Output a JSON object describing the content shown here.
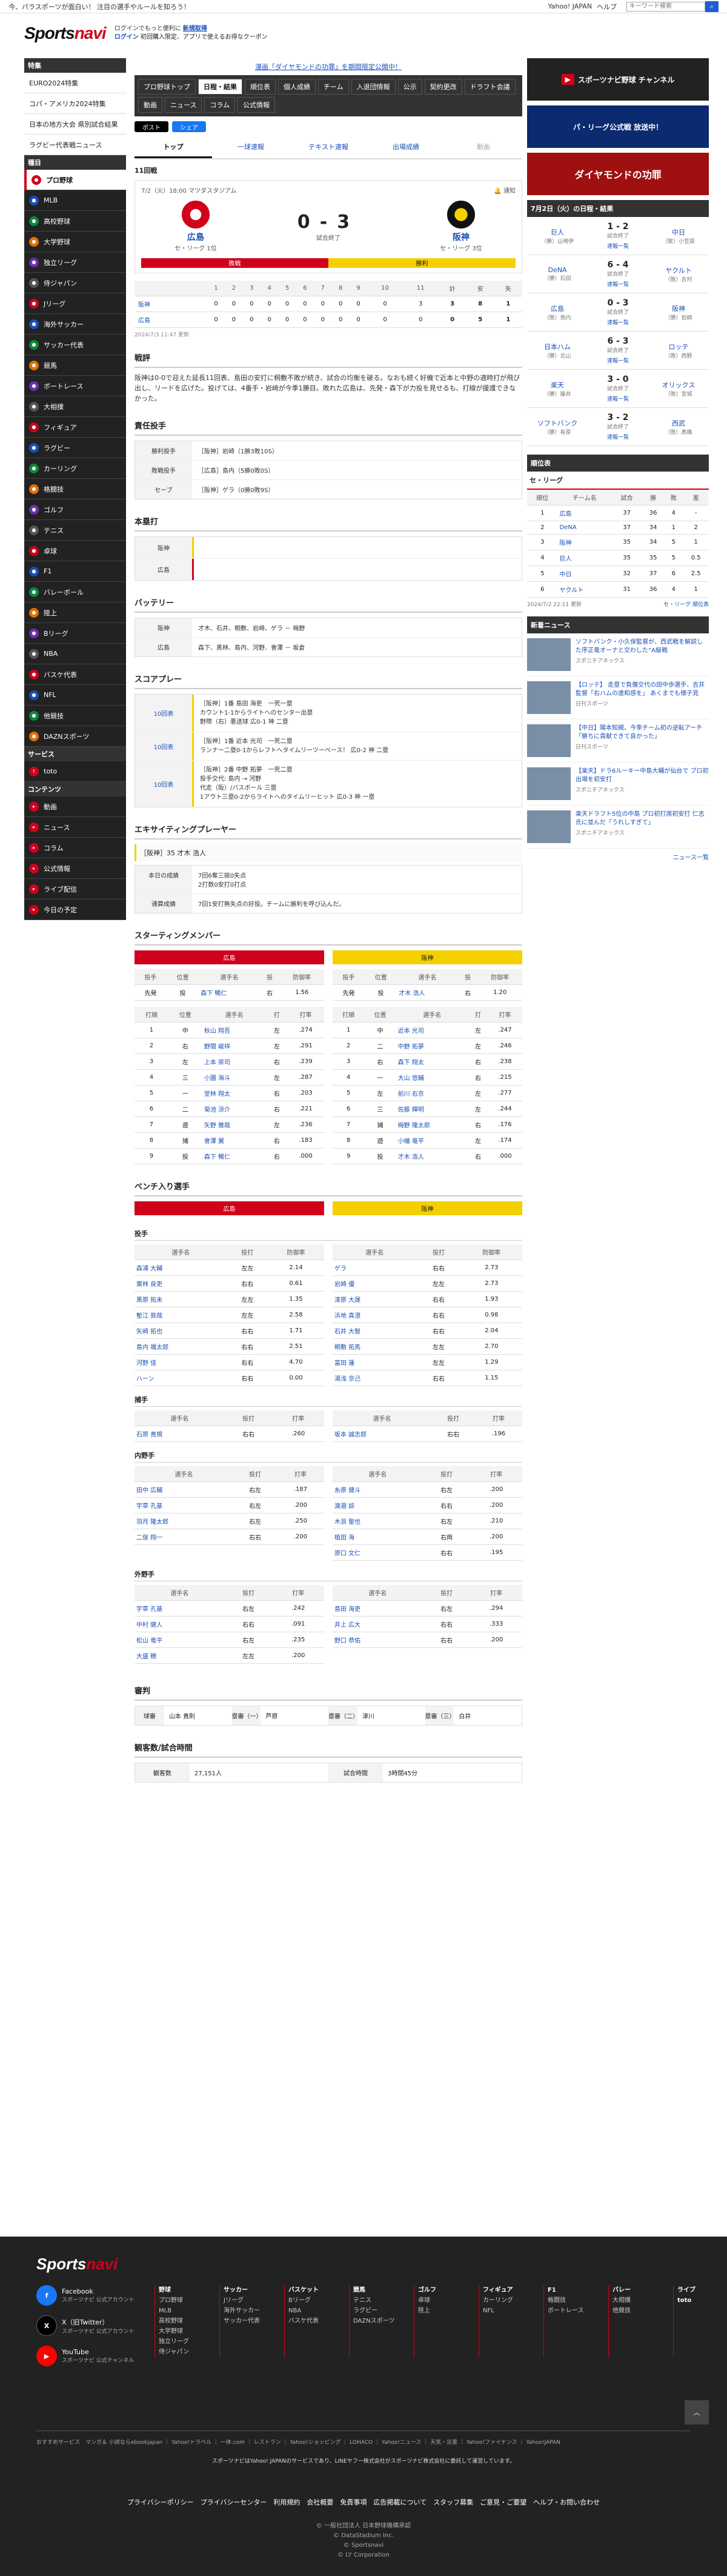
{
  "topbar": {
    "ticker": "今、パラスポーツが面白い！ 注目の選手やルールを知ろう！",
    "yahoo": "Yahoo! JAPAN",
    "help": "ヘルプ",
    "search_placeholder": "キーワード検索"
  },
  "header": {
    "logo_a": "Sports",
    "logo_b": "navi",
    "promo1_a": "ログインでもっと便利に",
    "promo1_b": "新規取得",
    "promo2_a": "ログイン",
    "promo2_b": "初回購入限定、アプリで使えるお得なクーポン"
  },
  "sidebar": {
    "head1": "特集",
    "feature": [
      "EURO2024特集",
      "コパ・アメリカ2024特集",
      "日本の地方大会 県別試合結果",
      "ラグビー代表戦ニュース"
    ],
    "head2": "種目",
    "sports": [
      "プロ野球",
      "MLB",
      "高校野球",
      "大学野球",
      "独立リーグ",
      "侍ジャパン",
      "Jリーグ",
      "海外サッカー",
      "サッカー代表",
      "競馬",
      "ボートレース",
      "大相撲",
      "フィギュア",
      "ラグビー",
      "カーリング",
      "格闘技",
      "ゴルフ",
      "テニス",
      "卓球",
      "F1",
      "バレーボール",
      "陸上",
      "Bリーグ",
      "NBA",
      "バスケ代表",
      "NFL",
      "他競技",
      "DAZNスポーツ"
    ],
    "head3": "サービス",
    "services": [
      "toto"
    ],
    "head4": "コンテンツ",
    "contents": [
      "動画",
      "ニュース",
      "コラム",
      "公式情報",
      "ライブ配信",
      "今日の予定"
    ]
  },
  "main": {
    "notice": "漫画「ダイヤモンドの功罪」を期間限定公開中！",
    "tabs": [
      "プロ野球トップ",
      "日程・結果",
      "順位表",
      "個人成績",
      "チーム",
      "入退団情報",
      "公示",
      "契約更改",
      "ドラフト会議",
      "動画",
      "ニュース",
      "コラム",
      "公式情報"
    ],
    "share_x": "ポスト",
    "share_fb": "シェア",
    "subtabs": [
      "トップ",
      "一球速報",
      "テキスト速報",
      "出場成績",
      "動画"
    ],
    "inning": "11回戦",
    "date": "7/2（火）18:00 マツダスタジアム",
    "notify": "通知",
    "home": {
      "name": "広島",
      "sub": "セ・リーグ 1位",
      "runs": "0"
    },
    "away": {
      "name": "阪神",
      "sub": "セ・リーグ 3位",
      "runs": "3"
    },
    "status": "試合終了",
    "lose": "敗戦",
    "win": "勝利",
    "linescore": {
      "headers": [
        "",
        "1",
        "2",
        "3",
        "4",
        "5",
        "6",
        "7",
        "8",
        "9",
        "10",
        "11",
        "計",
        "安",
        "失"
      ],
      "rows": [
        [
          "阪神",
          "0",
          "0",
          "0",
          "0",
          "0",
          "0",
          "0",
          "0",
          "0",
          "0",
          "3",
          "3",
          "8",
          "1"
        ],
        [
          "広島",
          "0",
          "0",
          "0",
          "0",
          "0",
          "0",
          "0",
          "0",
          "0",
          "0",
          "0",
          "0",
          "5",
          "1"
        ]
      ]
    },
    "updated": "2024/7/3 11:47 更新",
    "summary_title": "戦評",
    "summary": "阪神は0-0で迎えた延長11回表、島田の安打に桐敷不敗が続き、試合の均衡を破る。なおも続く好機で近本と中野の適時打が飛び出し、リードを広げた。投げては、4番手・岩崎が今季1勝目。敗れた広島は、先発・森下が力投を見せるも、打線が援護できなかった。",
    "pitchers_title": "責任投手",
    "pitchers": [
      {
        "k": "勝利投手",
        "v": "［阪神］岩崎（1勝3敗10S）"
      },
      {
        "k": "敗戦投手",
        "v": "［広島］島内（5勝0敗0S）"
      },
      {
        "k": "セーブ",
        "v": "［阪神］ゲラ（0勝0敗9S）"
      }
    ],
    "hr_title": "本塁打",
    "hr": [
      {
        "k": "阪神"
      },
      {
        "k": "広島"
      }
    ],
    "battery_title": "バッテリー",
    "battery": [
      {
        "k": "阪神",
        "v": "才木、石井、桐敷、岩崎、ゲラ － 梅野"
      },
      {
        "k": "広島",
        "v": "森下、黒林、島内、河野、會澤 － 坂倉"
      }
    ],
    "scoring_title": "スコアプレー",
    "scoring": [
      {
        "k": "10回表",
        "v": "［阪神］1番 島田 海吏　一死一塁\nカウント1-1からライトへのセンター出塁\n野際（右）悪送球 広0-1 神 二塁"
      },
      {
        "k": "10回表",
        "v": "［阪神］1番 近本 光司　一死二塁\nランナー二塁0-1からレフトへタイムリーツーベース！ 広0-2 神 二塁"
      },
      {
        "k": "10回表",
        "v": "［阪神］2番 中野 拓夢　一死二塁\n投手交代: 島内 → 河野\n代走（阪）/バスボール 三塁\n1アウト三塁0-2からライトへのタイムリーヒット 広0-3 神 一塁"
      }
    ],
    "mvp_title": "エキサイティングプレーヤー",
    "mvp_name": "［阪神］35 才木 浩人",
    "mvp": [
      {
        "k": "本日の成績",
        "v": "7回6奪三振0失点\n2打数0安打0打点"
      },
      {
        "k": "通算成績",
        "v": "7回1安打無失点の好投。チームに勝利を呼び込んだ。"
      }
    ],
    "lineup_title": "スターティングメンバー",
    "lineup_home_label": "広島",
    "lineup_away_label": "阪神",
    "sp_headers": [
      "投手",
      "位置",
      "選手名",
      "投",
      "防御率"
    ],
    "sp_home": [
      "先発",
      "投",
      "森下 暢仁",
      "右",
      "1.56"
    ],
    "sp_away": [
      "先発",
      "投",
      "才木 浩人",
      "右",
      "1.20"
    ],
    "bat_headers": [
      "打順",
      "位置",
      "選手名",
      "打",
      "打率"
    ],
    "bat_home": [
      [
        "1",
        "中",
        "秋山 翔吾",
        "左",
        ".274"
      ],
      [
        "2",
        "右",
        "野間 峻祥",
        "左",
        ".291"
      ],
      [
        "3",
        "左",
        "上本 崇司",
        "右",
        ".239"
      ],
      [
        "4",
        "三",
        "小園 海斗",
        "左",
        ".287"
      ],
      [
        "5",
        "一",
        "堂林 翔太",
        "右",
        ".203"
      ],
      [
        "6",
        "二",
        "菊池 涼介",
        "右",
        ".221"
      ],
      [
        "7",
        "遊",
        "矢野 雅哉",
        "左",
        ".236"
      ],
      [
        "8",
        "捕",
        "會澤 翼",
        "右",
        ".183"
      ],
      [
        "9",
        "投",
        "森下 暢仁",
        "右",
        ".000"
      ]
    ],
    "bat_away": [
      [
        "1",
        "中",
        "近本 光司",
        "左",
        ".247"
      ],
      [
        "2",
        "二",
        "中野 拓夢",
        "左",
        ".246"
      ],
      [
        "3",
        "右",
        "森下 翔太",
        "右",
        ".238"
      ],
      [
        "4",
        "一",
        "大山 悠輔",
        "右",
        ".215"
      ],
      [
        "5",
        "左",
        "前川 右京",
        "左",
        ".277"
      ],
      [
        "6",
        "三",
        "佐藤 輝明",
        "左",
        ".244"
      ],
      [
        "7",
        "捕",
        "梅野 隆太郎",
        "右",
        ".176"
      ],
      [
        "8",
        "遊",
        "小幡 竜平",
        "左",
        ".174"
      ],
      [
        "9",
        "投",
        "才木 浩人",
        "右",
        ".000"
      ]
    ],
    "bench_title": "ベンチ入り選手",
    "bench_pitch": "投手",
    "bench_p_headers": [
      "選手名",
      "投打",
      "防御率"
    ],
    "bench_p_home": [
      [
        "森浦 大輔",
        "左左",
        "2.14"
      ],
      [
        "栗林 良吏",
        "右右",
        "0.61"
      ],
      [
        "黒原 拓未",
        "左左",
        "1.35"
      ],
      [
        "塹江 敦哉",
        "左左",
        "2.58"
      ],
      [
        "矢崎 拓也",
        "右右",
        "1.71"
      ],
      [
        "島内 颯太郎",
        "右右",
        "2.51"
      ],
      [
        "河野 佳",
        "右右",
        "4.70"
      ],
      [
        "ハーン",
        "右右",
        "0.00"
      ]
    ],
    "bench_p_away": [
      [
        "ゲラ",
        "右右",
        "2.73"
      ],
      [
        "岩崎 優",
        "左左",
        "2.73"
      ],
      [
        "漆原 大晟",
        "右右",
        "1.93"
      ],
      [
        "浜地 真澄",
        "右右",
        "0.98"
      ],
      [
        "石井 大智",
        "右右",
        "2.04"
      ],
      [
        "桐敷 拓馬",
        "左左",
        "2.70"
      ],
      [
        "富田 蓮",
        "左左",
        "1.29"
      ],
      [
        "湯浅 京己",
        "右右",
        "1.15"
      ]
    ],
    "bench_catch": "捕手",
    "bench_b_headers": [
      "選手名",
      "投打",
      "打率"
    ],
    "bench_c_home": [
      [
        "石原 貴規",
        "右右",
        ".260"
      ]
    ],
    "bench_c_away": [
      [
        "坂本 誠志郎",
        "右右",
        ".196"
      ]
    ],
    "bench_inf": "内野手",
    "bench_i_home": [
      [
        "田中 広輔",
        "右左",
        ".187"
      ],
      [
        "宇草 孔基",
        "右左",
        ".200"
      ],
      [
        "羽月 隆太郎",
        "右左",
        ".250"
      ],
      [
        "二俣 翔一",
        "右右",
        ".200"
      ]
    ],
    "bench_i_away": [
      [
        "糸原 健斗",
        "右左",
        ".200"
      ],
      [
        "渡邉 諒",
        "右右",
        ".200"
      ],
      [
        "木浪 聖也",
        "右左",
        ".210"
      ],
      [
        "植田 海",
        "右両",
        ".200"
      ],
      [
        "原口 文仁",
        "右右",
        ".195"
      ]
    ],
    "bench_out": "外野手",
    "bench_o_home": [
      [
        "宇草 孔基",
        "右左",
        ".242"
      ],
      [
        "中村 健人",
        "右右",
        ".091"
      ],
      [
        "松山 竜平",
        "右左",
        ".235"
      ],
      [
        "大盛 穂",
        "左左",
        ".200"
      ]
    ],
    "bench_o_away": [
      [
        "島田 海吏",
        "右左",
        ".294"
      ],
      [
        "井上 広大",
        "右右",
        ".333"
      ],
      [
        "野口 恭佑",
        "右右",
        ".200"
      ]
    ],
    "ump_title": "審判",
    "umps": [
      {
        "k": "球審",
        "v": "山本 貴則"
      },
      {
        "k": "塁審（一）",
        "v": "芦原"
      },
      {
        "k": "塁審（二）",
        "v": "津川"
      },
      {
        "k": "塁審（三）",
        "v": "白井"
      }
    ],
    "att_title": "観客数/試合時間",
    "att": {
      "k1": "観客数",
      "v1": "27,151人",
      "k2": "試合時間",
      "v2": "3時間45分"
    }
  },
  "right": {
    "banner1": "スポーツナビ野球 チャンネル",
    "banner2": "パ・リーグ公式戦 放送中！",
    "banner3": "ダイヤモンドの功罪",
    "schedule_title": "7月2日（火）の日程・結果",
    "games": [
      {
        "a": "巨人",
        "ap": "（勝）山﨑伊",
        "s": "1 - 2",
        "b": "中日",
        "bp": "（敗）小笠原"
      },
      {
        "a": "DeNA",
        "ap": "（勝）石田",
        "s": "6 - 4",
        "b": "ヤクルト",
        "bp": "（敗）吉村"
      },
      {
        "a": "広島",
        "ap": "（敗）島内",
        "s": "0 - 3",
        "b": "阪神",
        "bp": "（勝）岩崎"
      },
      {
        "a": "日本ハム",
        "ap": "（勝）北山",
        "s": "6 - 3",
        "b": "ロッテ",
        "bp": "（敗）西野"
      },
      {
        "a": "楽天",
        "ap": "（勝）藤井",
        "s": "3 - 0",
        "b": "オリックス",
        "bp": "（敗）宮城"
      },
      {
        "a": "ソフトバンク",
        "ap": "（勝）有原",
        "s": "3 - 2",
        "b": "西武",
        "bp": "（敗）髙橋"
      }
    ],
    "final": "試合終了",
    "live": "速報一覧",
    "stand_title": "順位表",
    "stand_league": "セ・リーグ",
    "stand_headers": [
      "順位",
      "チーム名",
      "試合",
      "勝",
      "敗",
      "差"
    ],
    "stand": [
      [
        "1",
        "広島",
        "37",
        "36",
        "4",
        "-"
      ],
      [
        "2",
        "DeNA",
        "37",
        "34",
        "1",
        "2"
      ],
      [
        "3",
        "阪神",
        "35",
        "34",
        "5",
        "1"
      ],
      [
        "4",
        "巨人",
        "35",
        "35",
        "5",
        "0.5"
      ],
      [
        "5",
        "中日",
        "32",
        "37",
        "6",
        "2.5"
      ],
      [
        "6",
        "ヤクルト",
        "31",
        "36",
        "4",
        "1"
      ]
    ],
    "stand_updated": "2024/7/2 22:11 更新",
    "stand_more": "セ・リーグ 順位表",
    "news_title": "新着ニュース",
    "news": [
      {
        "t": "ソフトバンク・小久保監督が、西武戦を解説した序正竜オーナと交わした“A級戦",
        "s": "スポニチアネックス"
      },
      {
        "t": "【ロッテ】 走塁で負傷交代の田中歩選手、吉井監督「右ハムの違和感を」 あくまでも様子見",
        "s": "日刊スポーツ"
      },
      {
        "t": "【中日】陽本知親、今季チーム初の逆転アーチ「勝ちに貢献できて良かった」",
        "s": "日刊スポーツ"
      },
      {
        "t": "【楽天】ドラ6ルーキー中島大輔が仙台で プロ初出場を初安打",
        "s": "スポニチアネックス"
      },
      {
        "t": "楽天ドラフト5位の中島 プロ初打席初安打 仁志氏に並んだ「うれしすぎて」",
        "s": "スポニチアネックス"
      }
    ],
    "news_more": "ニュース一覧"
  },
  "footer": {
    "logo_a": "Sports",
    "logo_b": "navi",
    "social": [
      {
        "n": "Facebook",
        "s": "スポーツナビ 公式アカウント"
      },
      {
        "n": "X（旧Twitter）",
        "s": "スポーツナビ 公式アカウント"
      },
      {
        "n": "YouTube",
        "s": "スポーツナビ 公式チャンネル"
      }
    ],
    "cols": [
      [
        "野球",
        "プロ野球",
        "MLB",
        "高校野球",
        "大学野球",
        "独立リーグ",
        "侍ジャパン"
      ],
      [
        "サッカー",
        "Jリーグ",
        "海外サッカー",
        "サッカー代表"
      ],
      [
        "バスケット",
        "Bリーグ",
        "NBA",
        "バスケ代表"
      ],
      [
        "競馬",
        "テニス",
        "ラグビー",
        "DAZNスポーツ"
      ],
      [
        "ゴルフ",
        "卓球",
        "陸上"
      ],
      [
        "フィギュア",
        "カーリング",
        "NFL"
      ],
      [
        "F1",
        "格闘技",
        "ボートレース"
      ],
      [
        "バレー",
        "大相撲",
        "他競技"
      ]
    ],
    "extra": [
      "ライブ",
      "toto"
    ],
    "small": "おすすめサービス　マンガ＆ 小説ならebookjapan ｜ Yahoo!トラベル ｜ 一休.com ｜ レストラン ｜ Yahoo!ショッピング ｜ LOHACO ｜ Yahoo!ニュース ｜ 天気・災害 ｜ Yahoo!ファイナンス ｜ Yahoo!JAPAN",
    "note": "スポーツナビはYahoo! JAPANのサービスであり、LINEヤフー株式会社がスポーツナビ株式会社に委託して運営しています。",
    "links": "プライバシーポリシー　プライバシーセンター　利用規約　会社概要　免責事項　広告掲載について　スタッフ募集　ご意見・ご要望　ヘルプ・お問い合わせ",
    "copy1": "© 一般社団法人 日本野球機構承認",
    "copy2": "© DataStadium Inc.",
    "copy3": "© Sportsnavi",
    "copy4": "© LY Corporation"
  }
}
